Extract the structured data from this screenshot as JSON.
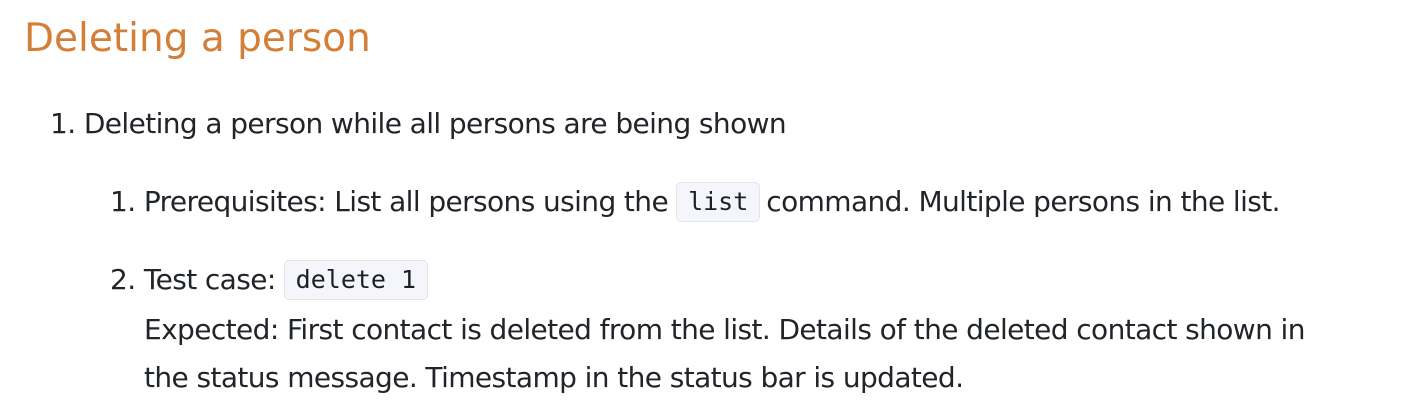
{
  "section": {
    "title": "Deleting a person"
  },
  "outer_item": {
    "number": "1.",
    "text": "Deleting a person while all persons are being shown"
  },
  "sub_items": [
    {
      "number": "1.",
      "text_before": "Prerequisites: List all persons using the",
      "code": "list",
      "text_after": "command. Multiple persons in the list."
    },
    {
      "number": "2.",
      "text_before": "Test case:",
      "code": "delete 1",
      "expected_line1": "Expected: First contact is deleted from the list. Details of the deleted contact shown in",
      "expected_line2": "the status message. Timestamp in the status bar is updated."
    }
  ]
}
